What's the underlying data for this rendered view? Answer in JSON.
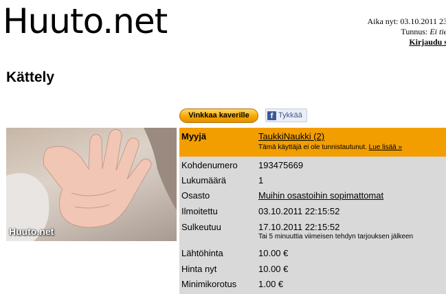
{
  "header": {
    "logo": "Huuto.net",
    "time_label": "Aika nyt: 03.10.2011 23",
    "login_prefix": "Tunnus: ",
    "login_state": "Ei tie",
    "login_link": "Kirjaudu s"
  },
  "item": {
    "title": "Kättely",
    "share_button": "Vinkkaa kaverille",
    "fb_like": "Tykkää",
    "image_watermark": "Huuto.net"
  },
  "seller": {
    "label": "Myyjä",
    "name": "TaukkiNaukki (2)",
    "note": "Tämä käyttäjä ei ole tunnistautunut.",
    "more_link": "Lue lisää »"
  },
  "details": [
    {
      "label": "Kohdenumero",
      "value": "193475669"
    },
    {
      "label": "Lukumäärä",
      "value": "1"
    },
    {
      "label": "Osasto",
      "value": "Muihin osastoihin sopimattomat"
    },
    {
      "label": "Ilmoitettu",
      "value": "03.10.2011 22:15:52"
    },
    {
      "label": "Sulkeutuu",
      "value": "17.10.2011 22:15:52",
      "note": "Tai 5 minuuttia viimeisen tehdyn tarjouksen jälkeen"
    },
    {
      "label": "Lähtöhinta",
      "value": "10.00 €"
    },
    {
      "label": "Hinta nyt",
      "value": "10.00 €"
    },
    {
      "label": "Minimikorotus",
      "value": "1.00 €"
    }
  ],
  "colors": {
    "accent": "#f29e00",
    "panel": "#d9d9d9",
    "facebook": "#3b5998"
  },
  "icons": {
    "facebook": "facebook-f-icon"
  }
}
